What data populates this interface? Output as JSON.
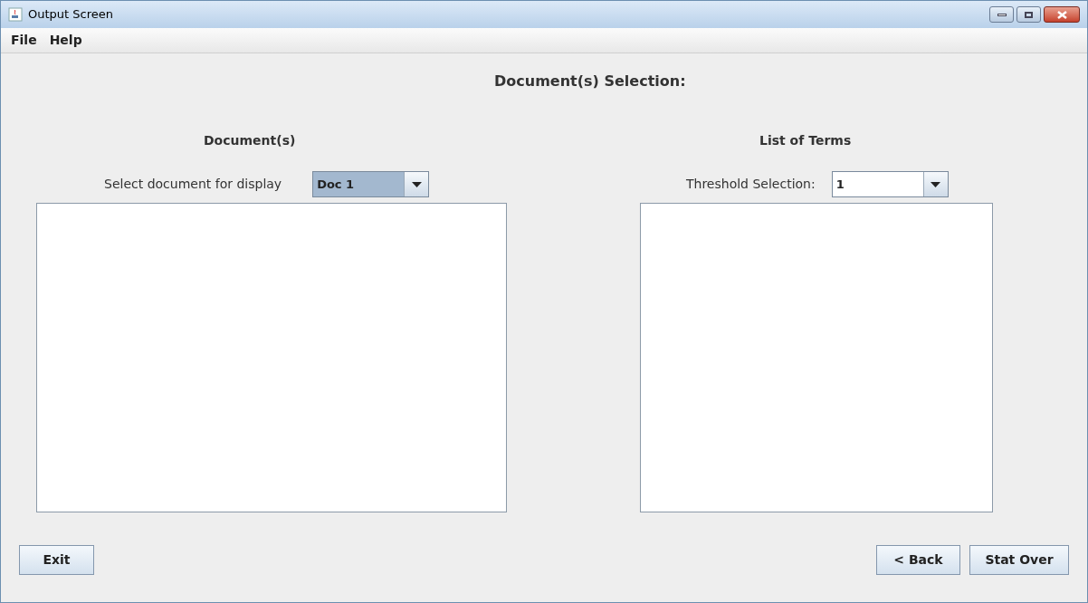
{
  "window": {
    "title": "Output Screen"
  },
  "menu": [
    "File",
    "Help"
  ],
  "heading": "Document(s) Selection:",
  "documents": {
    "title": "Document(s)",
    "label": "Select document for display",
    "combo": {
      "value": "Doc 1",
      "focused": true
    }
  },
  "terms": {
    "title": "List of Terms",
    "label": "Threshold Selection:",
    "combo": {
      "value": "1",
      "focused": false
    }
  },
  "buttons_left": [
    "Exit"
  ],
  "buttons_right": [
    "< Back",
    "Stat Over"
  ]
}
